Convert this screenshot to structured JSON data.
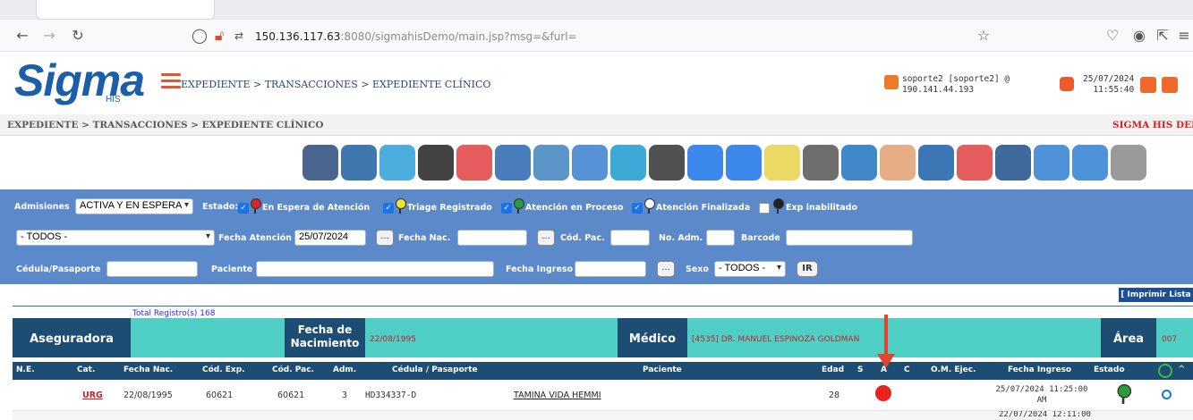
{
  "browser": {
    "url_host": "150.136.117.63",
    "url_rest": ":8080/sigmahisDemo/main.jsp?msg=&furl="
  },
  "app": {
    "logo": "Sigma",
    "logo_sub": "HIS",
    "breadcrumb_top": "EXPEDIENTE > TRANSACCIONES > EXPEDIENTE CLÍNICO",
    "user_line1": "soporte2 [soporte2] @",
    "user_line2": "190.141.44.193",
    "date_line1": "25/07/2024",
    "date_line2": "11:55:40",
    "breadcrumb_second": "EXPEDIENTE > TRANSACCIONES > EXPEDIENTE CLÍNICO",
    "brand_right": "SIGMA HIS DEM"
  },
  "toolbar_icons": [
    "org-chart-icon",
    "pill-icon",
    "lungs-icon",
    "add-folder-icon",
    "home-medical-icon",
    "scale-icon",
    "doctor-icon",
    "staff-icon",
    "bed-icon",
    "monitor-icon",
    "lock-icon",
    "chat-icon",
    "checklist-icon",
    "printer-icon",
    "search-icon",
    "baby-icon",
    "bandage-icon",
    "home-icon",
    "rx-icon",
    "patient-tag-icon",
    "patient-tag-icon-2",
    "gauge-icon"
  ],
  "filters": {
    "admisiones_label": "Admisiones",
    "admisiones_value": "ACTIVA Y EN ESPERA",
    "estado_label": "Estado:",
    "status_espera": "En Espera de Atención",
    "status_triage": "Triage Registrado",
    "status_proceso": "Atención en Proceso",
    "status_finalizada": "Atención Finalizada",
    "status_inhabilitado": "Exp inabilitado",
    "todos_value": "- TODOS -",
    "fecha_atencion_label": "Fecha Atención",
    "fecha_atencion_value": "25/07/2024",
    "fecha_nac_label": "Fecha Nac.",
    "cod_pac_label": "Cód. Pac.",
    "no_adm_label": "No. Adm.",
    "barcode_label": "Barcode",
    "cedula_label": "Cédula/Pasaporte",
    "paciente_label": "Paciente",
    "fecha_ingreso_label": "Fecha Ingreso",
    "sexo_label": "Sexo",
    "sexo_value": "- TODOS -",
    "ir_label": "IR",
    "dots": "..."
  },
  "print_link": "[ Imprimir Lista ]",
  "summary": {
    "total": "Total Registro(s) 168",
    "aseguradora": "Aseguradora",
    "fecha_nac_label_1": "Fecha de",
    "fecha_nac_label_2": "Nacimiento",
    "fecha_nac_value": "22/08/1995",
    "medico_label": "Médico",
    "medico_value": "[4535] DR. MANUEL ESPINOZA GOLDMAN",
    "area_label": "Área",
    "area_value": "007"
  },
  "columns": [
    "N.E.",
    "Cat.",
    "Fecha Nac.",
    "Cód. Exp.",
    "Cód. Pac.",
    "Adm.",
    "Cédula / Pasaporte",
    "Paciente",
    "Edad",
    "S",
    "A",
    "C",
    "O.M. Ejec.",
    "Fecha Ingreso",
    "Estado"
  ],
  "rows": [
    {
      "ne": "",
      "cat": "URG",
      "fecha_nac": "22/08/1995",
      "cod_exp": "60621",
      "cod_pac": "60621",
      "adm": "3",
      "cedula": "HD334337-D",
      "paciente": "TAMINA VIDA HEMMI",
      "edad": "28",
      "fecha_ingreso_1": "25/07/2024 11:25:00",
      "fecha_ingreso_2": "AM"
    }
  ],
  "row2_partial": {
    "fecha_ingreso": "22/07/2024 12:11:00"
  },
  "colors": {
    "header_blue": "#5c89c9",
    "dark_band": "#1d4d72",
    "teal": "#4ecec4",
    "alert_red": "#e8241f"
  }
}
